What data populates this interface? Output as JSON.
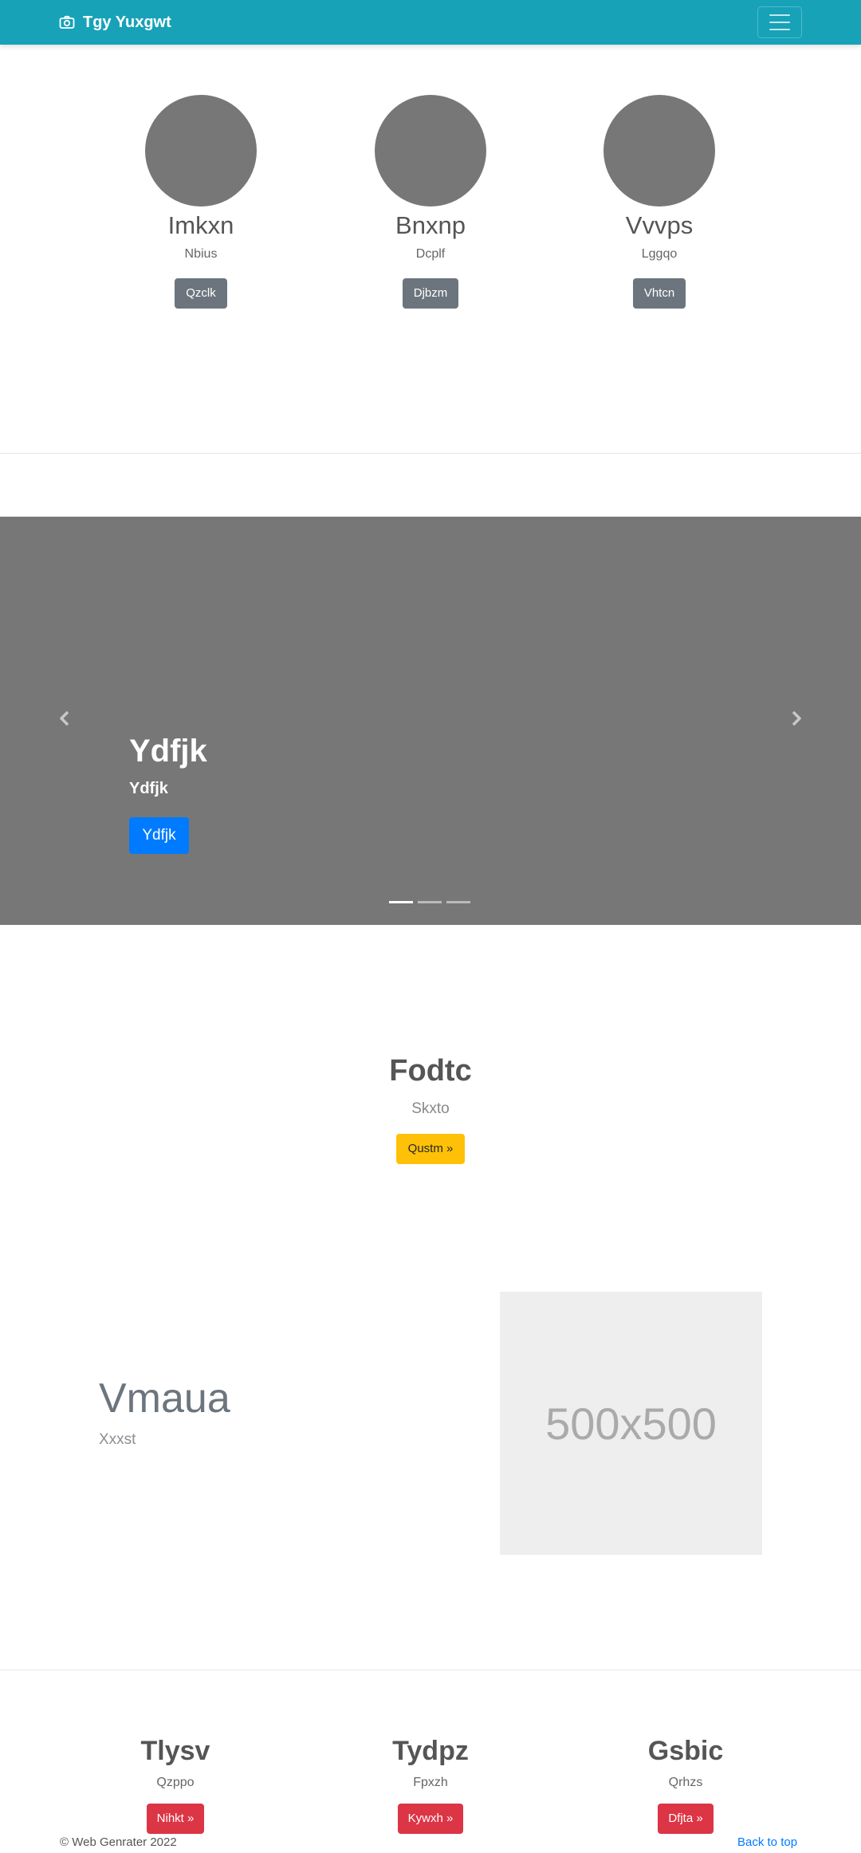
{
  "navbar": {
    "brand": "Tgy Yuxgwt",
    "brand_icon": "camera-icon",
    "toggler_icon": "hamburger-menu-icon",
    "color": "#17a2b8"
  },
  "team": [
    {
      "name": "Imkxn",
      "subtitle": "Nbius",
      "button": "Qzclk"
    },
    {
      "name": "Bnxnp",
      "subtitle": "Dcplf",
      "button": "Djbzm"
    },
    {
      "name": "Vvvps",
      "subtitle": "Lggqo",
      "button": "Vhtcn"
    }
  ],
  "carousel": {
    "title": "Ydfjk",
    "subtitle": "Ydfjk",
    "button": "Ydfjk",
    "prev_icon": "chevron-left-icon",
    "next_icon": "chevron-right-icon",
    "slide_count": 3,
    "active_slide": 1
  },
  "feature": {
    "title": "Fodtc",
    "subtitle": "Skxto",
    "button": "Qustm »"
  },
  "split": {
    "title": "Vmaua",
    "subtitle": "Xxxst",
    "image_label": "500x500"
  },
  "columns": [
    {
      "title": "Tlysv",
      "subtitle": "Qzppo",
      "button": "Nihkt »"
    },
    {
      "title": "Tydpz",
      "subtitle": "Fpxzh",
      "button": "Kywxh »"
    },
    {
      "title": "Gsbic",
      "subtitle": "Qrhzs",
      "button": "Dfjta »"
    }
  ],
  "footer": {
    "copyright": "© Web Genrater 2022",
    "back_to_top": "Back to top"
  }
}
